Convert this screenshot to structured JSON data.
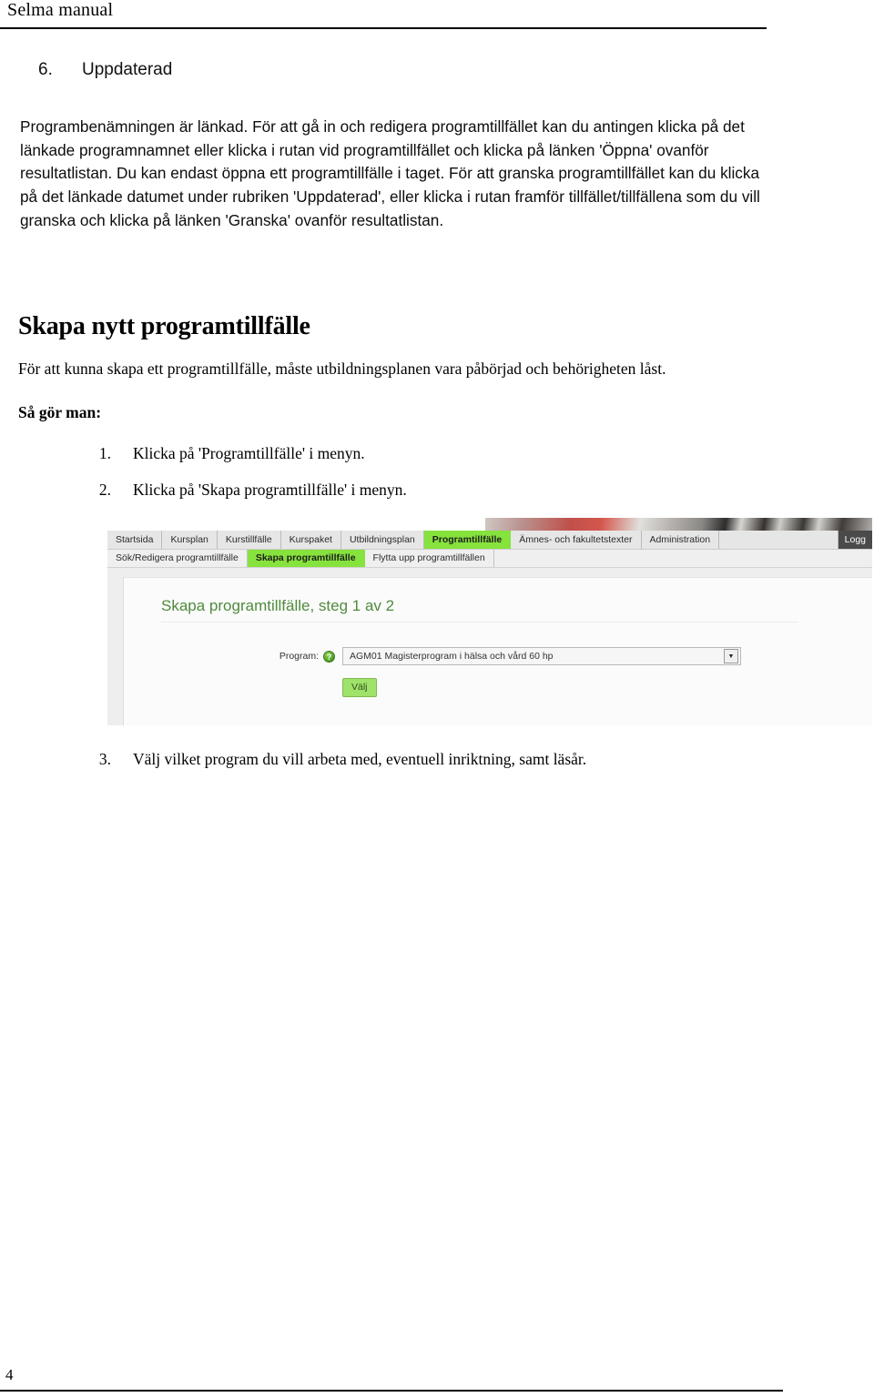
{
  "document": {
    "header_title": "Selma manual",
    "page_number": "4",
    "section": {
      "number": "6.",
      "title": "Uppdaterad"
    },
    "intro_paragraph": "Programbenämningen är länkad. För att gå in och redigera programtillfället kan du antingen klicka på det länkade programnamnet eller klicka i rutan vid programtillfället och klicka på länken 'Öppna' ovanför resultatlistan. Du kan endast öppna ett programtillfälle i taget. För att granska programtillfället kan du klicka på det länkade datumet under rubriken 'Uppdaterad', eller klicka i rutan framför tillfället/tillfällena som du vill granska och klicka på länken 'Granska' ovanför resultatlistan.",
    "block_heading": "Skapa nytt programtillfälle",
    "serif_paragraph": "För att kunna skapa ett programtillfälle, måste utbildningsplanen vara påbörjad och behörigheten låst.",
    "sub_heading": "Så gör man:",
    "steps": [
      {
        "marker": "1.",
        "text": "Klicka på 'Programtillfälle' i menyn."
      },
      {
        "marker": "2.",
        "text": "Klicka på 'Skapa programtillfälle' i menyn."
      },
      {
        "marker": "3.",
        "text": "Välj vilket program du vill arbeta med, eventuell inriktning, samt läsår."
      }
    ]
  },
  "app_screenshot": {
    "main_tabs": [
      {
        "label": "Startsida",
        "active": false
      },
      {
        "label": "Kursplan",
        "active": false
      },
      {
        "label": "Kurstillfälle",
        "active": false
      },
      {
        "label": "Kurspaket",
        "active": false
      },
      {
        "label": "Utbildningsplan",
        "active": false
      },
      {
        "label": "Programtillfälle",
        "active": true
      },
      {
        "label": "Ämnes- och fakultetstexter",
        "active": false
      },
      {
        "label": "Administration",
        "active": false
      }
    ],
    "logout_label": "Logg",
    "sub_tabs": [
      {
        "label": "Sök/Redigera programtillfälle",
        "active": false
      },
      {
        "label": "Skapa programtillfälle",
        "active": true
      },
      {
        "label": "Flytta upp programtillfällen",
        "active": false
      }
    ],
    "panel_title": "Skapa programtillfälle, steg 1 av 2",
    "form": {
      "program_label": "Program:",
      "help_icon_glyph": "?",
      "program_value": "AGM01 Magisterprogram i hälsa och vård 60 hp",
      "dropdown_arrow_glyph": "▼",
      "submit_label": "Välj"
    },
    "colors": {
      "active_tab_green": "#86e23c",
      "panel_title_green": "#4f8a3d",
      "button_green": "#9fe36a",
      "logout_dark": "#4a4a4a"
    }
  }
}
